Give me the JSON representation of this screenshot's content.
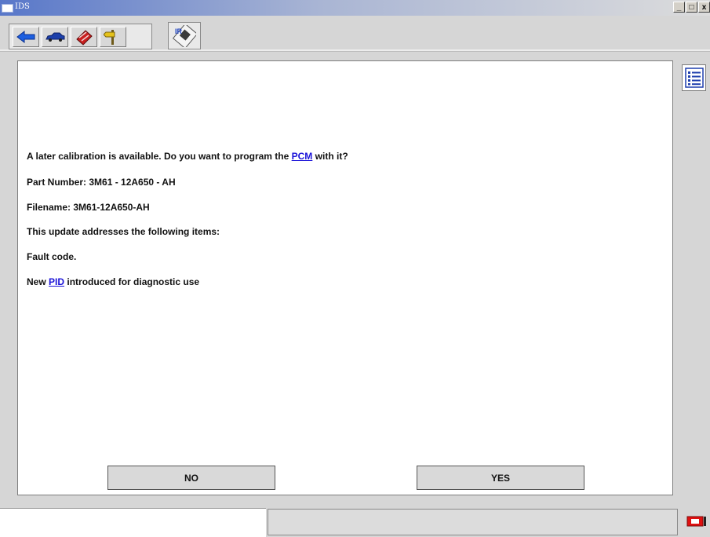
{
  "window": {
    "title": "IDS"
  },
  "window_controls": {
    "minimize": "_",
    "maximize": "□",
    "close": "x"
  },
  "toolbar": {
    "icons": [
      "back-arrow-icon",
      "vehicle-icon",
      "toolbox-icon",
      "signpost-icon"
    ],
    "single_icon": "rewrite-tool-icon"
  },
  "message": {
    "line1_before": "A later calibration is available. Do you want to program the",
    "line1_link": "PCM",
    "line1_after": "with it?",
    "part_number": "Part Number:  3M61 - 12A650 - AH",
    "filename": "Filename:  3M61-12A650-AH",
    "update_intro": "This update addresses the following items:",
    "item1": "Fault code.",
    "item2_before": "New",
    "item2_link": "PID",
    "item2_after": "introduced for diagnostic use"
  },
  "buttons": {
    "no_label": "NO",
    "yes_label": "YES"
  },
  "colors": {
    "link": "#1a12d8",
    "panel": "#ffffff",
    "background": "#d6d6d6",
    "status_icon": "#e01010"
  }
}
